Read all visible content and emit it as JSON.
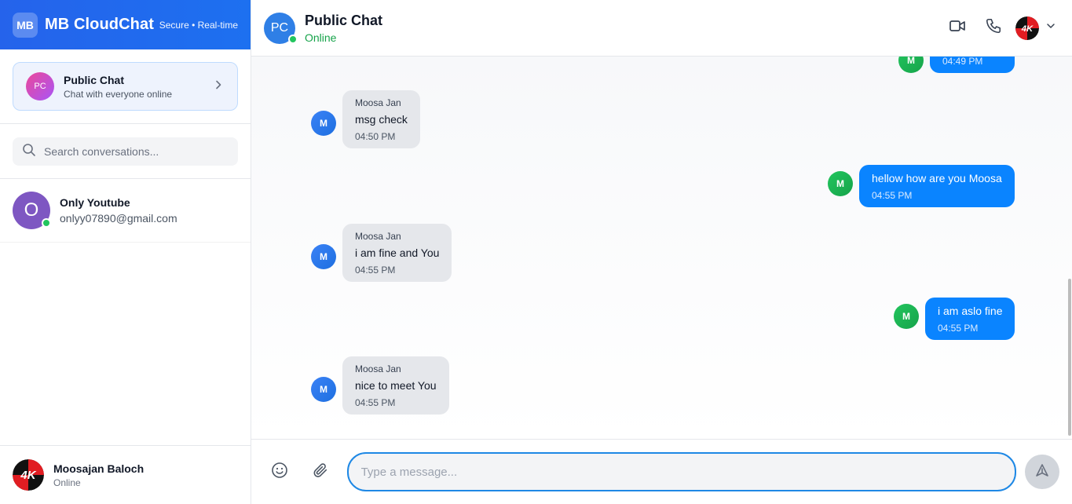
{
  "brand": {
    "logo": "MB",
    "name": "MB CloudChat",
    "tagline": "Secure • Real-time"
  },
  "public_chat": {
    "avatar": "PC",
    "title": "Public Chat",
    "subtitle": "Chat with everyone online"
  },
  "search": {
    "placeholder": "Search conversations..."
  },
  "conversations": [
    {
      "avatar": "O",
      "name": "Only Youtube",
      "email": "onlyy07890@gmail.com",
      "online": true
    }
  ],
  "current_user": {
    "name": "Moosajan Baloch",
    "status": "Online",
    "avatar_text": "4K"
  },
  "header": {
    "avatar": "PC",
    "title": "Public Chat",
    "status": "Online",
    "user_avatar_text": "4K"
  },
  "messages": [
    {
      "direction": "out",
      "avatar": "M",
      "text": "",
      "time": "04:49 PM"
    },
    {
      "direction": "in",
      "avatar": "M",
      "sender": "Moosa Jan",
      "text": "msg check",
      "time": "04:50 PM"
    },
    {
      "direction": "out",
      "avatar": "M",
      "text": "hellow how are you Moosa",
      "time": "04:55 PM"
    },
    {
      "direction": "in",
      "avatar": "M",
      "sender": "Moosa Jan",
      "text": "i am fine and You",
      "time": "04:55 PM"
    },
    {
      "direction": "out",
      "avatar": "M",
      "text": "i am aslo fine",
      "time": "04:55 PM"
    },
    {
      "direction": "in",
      "avatar": "M",
      "sender": "Moosa Jan",
      "text": "nice to meet You",
      "time": "04:55 PM"
    }
  ],
  "composer": {
    "placeholder": "Type a message...",
    "value": ""
  },
  "colors": {
    "brand": "#2563eb",
    "online": "#22c55e",
    "out_bubble": "#0a84ff",
    "in_bubble": "#e5e7eb"
  }
}
